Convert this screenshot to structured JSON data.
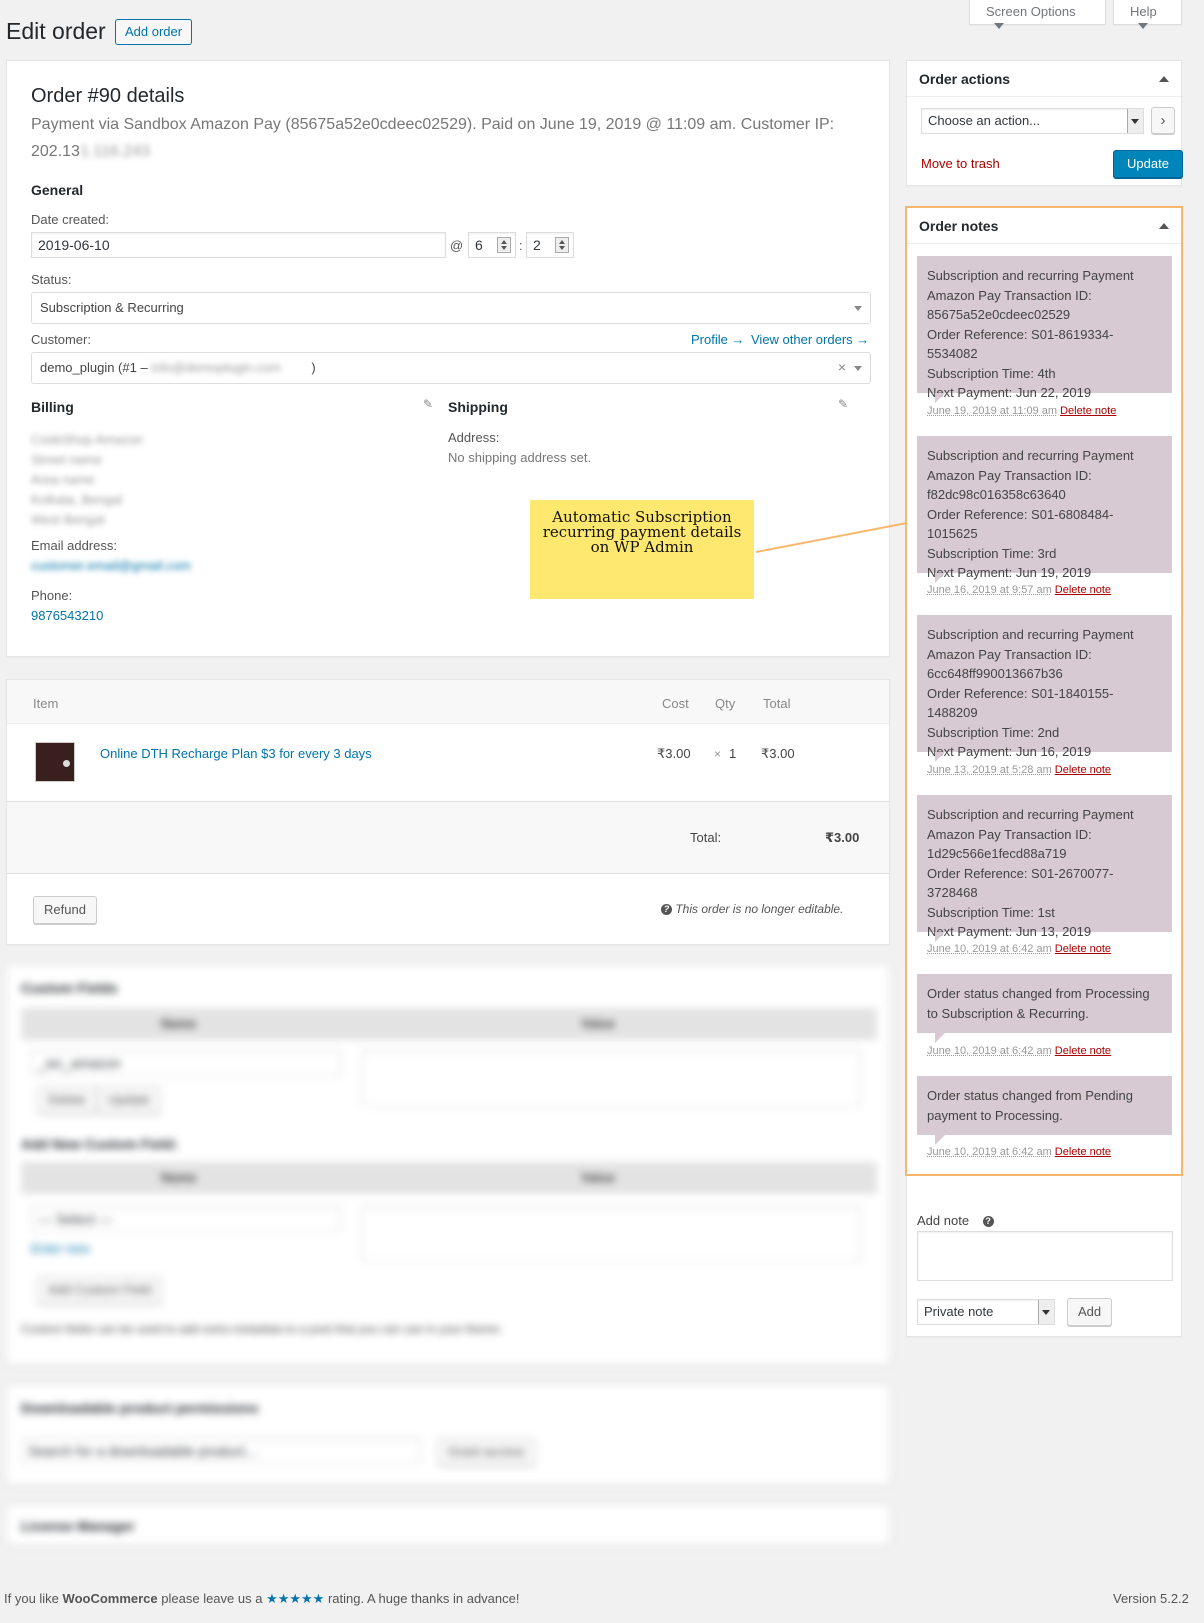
{
  "page": {
    "title": "Edit order",
    "add_order": "Add order",
    "screen_options": "Screen Options",
    "help": "Help"
  },
  "order": {
    "heading": "Order #90 details",
    "payment_line": "Payment via Sandbox Amazon Pay (85675a52e0cdeec02529). Paid on June 19, 2019 @ 11:09 am. Customer IP:",
    "ip_prefix": "202.13",
    "ip_hidden": "1.116.243",
    "general_heading": "General",
    "date_created_label": "Date created:",
    "date_value": "2019-06-10",
    "at": "@",
    "hour": "6",
    "colon": ":",
    "minute": "2",
    "status_label": "Status:",
    "status_value": "Subscription & Recurring",
    "customer_label": "Customer:",
    "profile_link": "Profile →",
    "view_other_orders": "View other orders →",
    "customer_value": "demo_plugin (#1 –",
    "customer_email_hidden": "info@demoplugin.com",
    "customer_close": ")",
    "clear_x": "×",
    "billing_heading": "Billing",
    "billing_lines": [
      "CodeShop Amazon",
      "Street name",
      "Area name",
      "Kolkata, Bengal",
      "West Bengal"
    ],
    "email_label": "Email address:",
    "email_hidden": "customer.email@gmail.com",
    "phone_label": "Phone:",
    "phone_value": "9876543210",
    "shipping_heading": "Shipping",
    "address_label": "Address:",
    "no_shipping": "No shipping address set.",
    "pencil_icon": "✎"
  },
  "items": {
    "col_item": "Item",
    "col_cost": "Cost",
    "col_qty": "Qty",
    "col_total": "Total",
    "rows": [
      {
        "name": "Online DTH Recharge Plan $3 for every 3 days",
        "cost": "₹3.00",
        "qty_x": "×",
        "qty": "1",
        "total": "₹3.00"
      }
    ],
    "total_label": "Total:",
    "total_value": "₹3.00",
    "refund": "Refund",
    "not_editable": "This order is no longer editable."
  },
  "blurred_sections": {
    "custom_fields": "Custom Fields",
    "name_col": "Name",
    "value_col": "Value",
    "field_key": "_wc_amazon",
    "delete": "Delete",
    "update": "Update",
    "add_new": "Add New Custom Field:",
    "select": "— Select —",
    "enter_new": "Enter new",
    "add_custom_field": "Add Custom Field",
    "footnote": "Custom fields can be used to add extra metadata to a post that you can use in your theme.",
    "downloadable": "Downloadable product permissions",
    "search_placeholder": "Search for a downloadable product…",
    "grant_access": "Grant access",
    "license_manager": "License Manager"
  },
  "order_actions": {
    "title": "Order actions",
    "choose": "Choose an action...",
    "move_to_trash": "Move to trash",
    "update": "Update"
  },
  "order_notes": {
    "title": "Order notes",
    "delete_label": "Delete note",
    "notes": [
      {
        "lines": [
          "Subscription and recurring Payment",
          "Amazon Pay Transaction ID:",
          "85675a52e0cdeec02529",
          "Order Reference: S01-8619334-5534082",
          "Subscription Time: 4th",
          "Next Payment: Jun 22, 2019"
        ],
        "date": "June 19, 2019 at 11:09 am"
      },
      {
        "lines": [
          "Subscription and recurring Payment",
          "Amazon Pay Transaction ID:",
          "f82dc98c016358c63640",
          "Order Reference: S01-6808484-1015625",
          "Subscription Time: 3rd",
          "Next Payment: Jun 19, 2019"
        ],
        "date": "June 16, 2019 at 9:57 am"
      },
      {
        "lines": [
          "Subscription and recurring Payment",
          "Amazon Pay Transaction ID:",
          "6cc648ff990013667b36",
          "Order Reference: S01-1840155-1488209",
          "Subscription Time: 2nd",
          "Next Payment: Jun 16, 2019"
        ],
        "date": "June 13, 2019 at 5:28 am"
      },
      {
        "lines": [
          "Subscription and recurring Payment",
          "Amazon Pay Transaction ID:",
          "1d29c566e1fecd88a719",
          "Order Reference: S01-2670077-3728468",
          "Subscription Time: 1st",
          "Next Payment: Jun 13, 2019"
        ],
        "date": "June 10, 2019 at 6:42 am"
      },
      {
        "lines": [
          "Order status changed from Processing",
          "to Subscription & Recurring."
        ],
        "date": "June 10, 2019 at 6:42 am"
      },
      {
        "lines": [
          "Order status changed from Pending",
          "payment to Processing."
        ],
        "date": "June 10, 2019 at 6:42 am"
      }
    ],
    "add_note_label": "Add note",
    "note_type": "Private note",
    "add_button": "Add"
  },
  "callout": {
    "lines": [
      "Automatic Subscription",
      "recurring payment details",
      "on WP Admin"
    ],
    "color": "#fee86f",
    "highlight_color": "#f9b66d"
  },
  "footer": {
    "left_prefix": "If you like ",
    "brand": "WooCommerce",
    "left_mid": " please leave us a ",
    "stars": "★★★★★",
    "left_suffix": " rating. A huge thanks in advance!",
    "version": "Version 5.2.2"
  }
}
